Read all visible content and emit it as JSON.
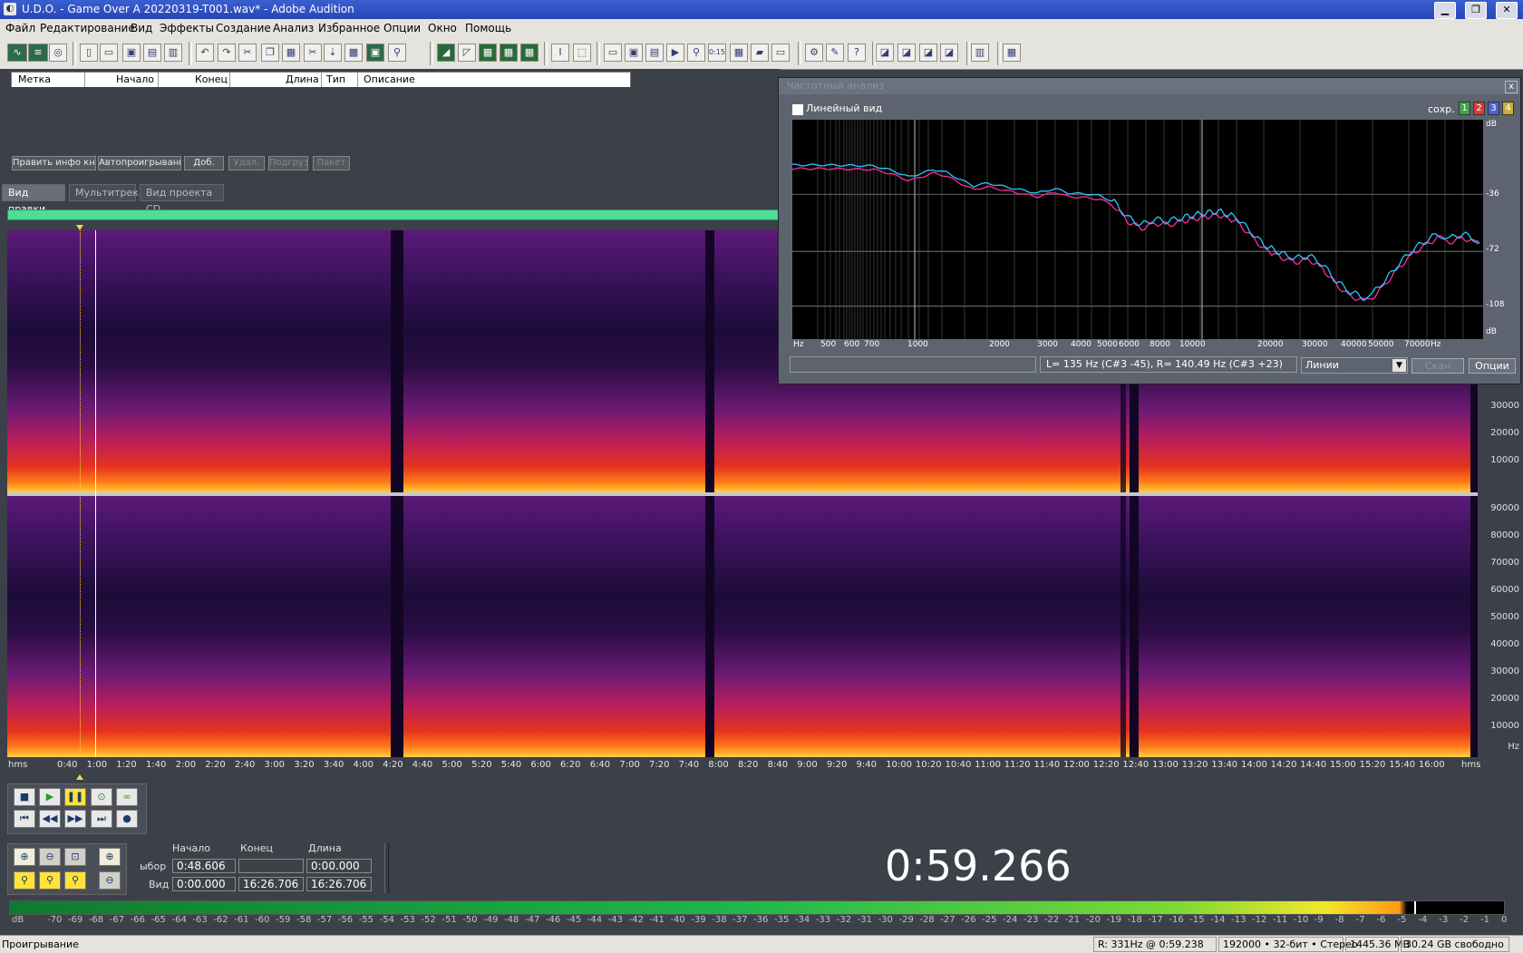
{
  "window": {
    "title": "U.D.O. - Game Over  A 20220319-T001.wav* - Adobe Audition",
    "minimize": "▁",
    "restore": "❐",
    "close": "✕"
  },
  "menu": [
    "Файл",
    "Редактирование",
    "Вид",
    "Эффекты",
    "Создание",
    "Анализ",
    "Избранное",
    "Опции",
    "Окно",
    "Помощь"
  ],
  "cue_list": {
    "columns": [
      "Метка",
      "Начало",
      "Конец",
      "Длина",
      "Тип",
      "Описание"
    ],
    "buttons": {
      "edit_info": "Править инфо книг",
      "autoplay": "Автопроигрывание",
      "add": "Доб.",
      "delete": "Удал.",
      "load": "Подгруз.",
      "batch": "Пакет"
    }
  },
  "view_tabs": [
    "Вид правки",
    "Мультитрек",
    "Вид проекта CD"
  ],
  "spectrogram": {
    "freq_ticks_ch1": [
      "30000",
      "20000",
      "10000"
    ],
    "freq_ticks_ch2": [
      "90000",
      "80000",
      "70000",
      "60000",
      "50000",
      "40000",
      "30000",
      "20000",
      "10000",
      "Hz"
    ]
  },
  "time_ruler": {
    "left_label": "hms",
    "right_label": "hms",
    "ticks": [
      "0:40",
      "1:00",
      "1:20",
      "1:40",
      "2:00",
      "2:20",
      "2:40",
      "3:00",
      "3:20",
      "3:40",
      "4:00",
      "4:20",
      "4:40",
      "5:00",
      "5:20",
      "5:40",
      "6:00",
      "6:20",
      "6:40",
      "7:00",
      "7:20",
      "7:40",
      "8:00",
      "8:20",
      "8:40",
      "9:00",
      "9:20",
      "9:40",
      "10:00",
      "10:20",
      "10:40",
      "11:00",
      "11:20",
      "11:40",
      "12:00",
      "12:20",
      "12:40",
      "13:00",
      "13:20",
      "13:40",
      "14:00",
      "14:20",
      "14:40",
      "15:00",
      "15:20",
      "15:40",
      "16:00"
    ]
  },
  "selection": {
    "headers": {
      "start": "Начало",
      "end": "Конец",
      "length": "Длина"
    },
    "row_selection_label": "ыбор",
    "row_view_label": "Вид",
    "selection_start": "0:48.606",
    "selection_end": "",
    "selection_length": "0:00.000",
    "view_start": "0:00.000",
    "view_end": "16:26.706",
    "view_length": "16:26.706"
  },
  "current_time": "0:59.266",
  "level_meter": {
    "unit": "dB",
    "ticks": [
      "-70",
      "-69",
      "-68",
      "-67",
      "-66",
      "-65",
      "-64",
      "-63",
      "-62",
      "-61",
      "-60",
      "-59",
      "-58",
      "-57",
      "-56",
      "-55",
      "-54",
      "-53",
      "-52",
      "-51",
      "-50",
      "-49",
      "-48",
      "-47",
      "-46",
      "-45",
      "-44",
      "-43",
      "-42",
      "-41",
      "-40",
      "-39",
      "-38",
      "-37",
      "-36",
      "-35",
      "-34",
      "-33",
      "-32",
      "-31",
      "-30",
      "-29",
      "-28",
      "-27",
      "-26",
      "-25",
      "-24",
      "-23",
      "-22",
      "-21",
      "-20",
      "-19",
      "-18",
      "-17",
      "-16",
      "-15",
      "-14",
      "-13",
      "-12",
      "-11",
      "-10",
      "-9",
      "-8",
      "-7",
      "-6",
      "-5",
      "-4",
      "-3",
      "-2",
      "-1",
      "0"
    ],
    "level_fraction": 0.935
  },
  "status": {
    "state": "Проигрывание",
    "cursor_info": "R: 331Hz @    0:59.238",
    "format": "192000 • 32-бит • Стерео",
    "file_size": "1445.36 MB",
    "free_space": "30.24 GB свободно"
  },
  "freq_analysis": {
    "title": "Частотный анализ",
    "close": "x",
    "linear_view": "Линейный вид",
    "save_label": "сохр.",
    "slots": [
      "1",
      "2",
      "3",
      "4"
    ],
    "slot_colors": [
      "#3aa848",
      "#d83a3a",
      "#4a62d8",
      "#c8b030"
    ],
    "y_unit": "dB",
    "y_ticks": [
      "-36",
      "-72",
      "-108"
    ],
    "x_ticks": [
      "Hz",
      "500",
      "600",
      "700",
      "1000",
      "2000",
      "3000",
      "4000",
      "5000",
      "6000",
      "8000",
      "10000",
      "20000",
      "30000",
      "40000",
      "50000",
      "70000",
      "Hz"
    ],
    "readout": "L=    135 Hz (C#3 -45), R= 140.49 Hz (C#3 +23)",
    "display_mode": "Линии",
    "scan_button": "Скан",
    "options_button": "Опции",
    "series": [
      {
        "color": "#ff2a9a",
        "channel": "L"
      },
      {
        "color": "#2ac8ff",
        "channel": "R"
      }
    ]
  }
}
